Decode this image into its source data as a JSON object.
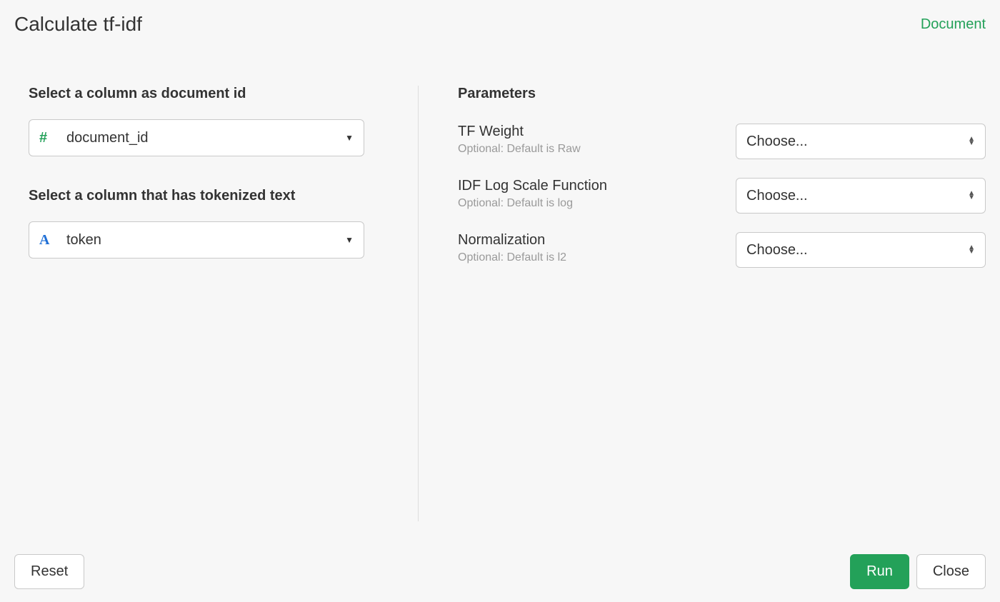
{
  "header": {
    "title": "Calculate tf-idf",
    "doc_link": "Document"
  },
  "left": {
    "doc_id_label": "Select a column as document id",
    "doc_id_value": "document_id",
    "token_label": "Select a column that has tokenized text",
    "token_value": "token"
  },
  "right": {
    "heading": "Parameters",
    "choose_placeholder": "Choose...",
    "params": [
      {
        "title": "TF Weight",
        "sub": "Optional: Default is Raw"
      },
      {
        "title": "IDF Log Scale Function",
        "sub": "Optional: Default is log"
      },
      {
        "title": "Normalization",
        "sub": "Optional: Default is l2"
      }
    ]
  },
  "footer": {
    "reset": "Reset",
    "run": "Run",
    "close": "Close"
  }
}
